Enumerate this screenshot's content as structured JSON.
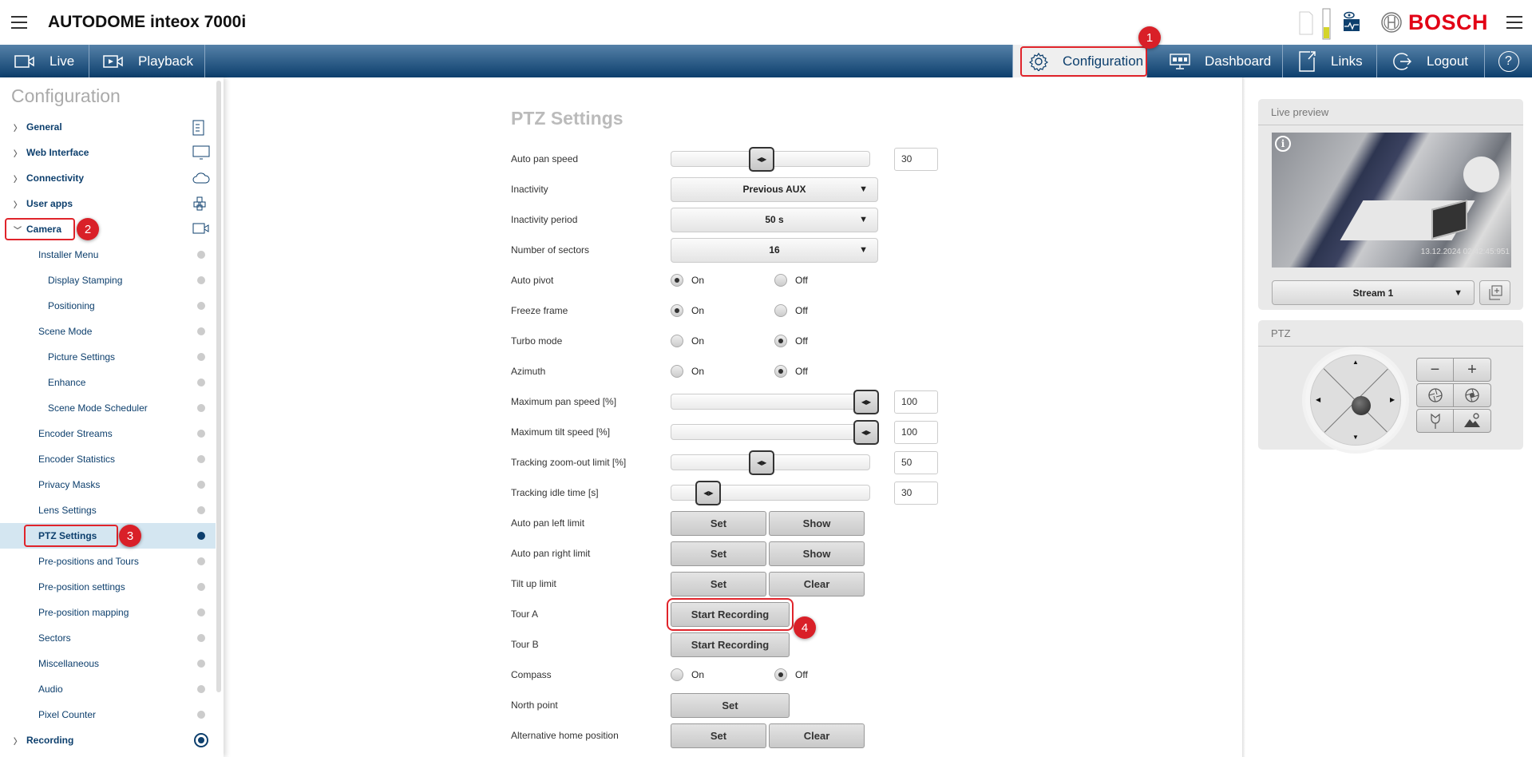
{
  "header": {
    "title": "AUTODOME inteox 7000i",
    "brand": "BOSCH"
  },
  "nav": {
    "live": "Live",
    "playback": "Playback",
    "configuration": "Configuration",
    "dashboard": "Dashboard",
    "links": "Links",
    "logout": "Logout",
    "help": "?"
  },
  "sidebar": {
    "title": "Configuration",
    "items": [
      {
        "label": "General",
        "level": 0,
        "icon": "checklist-icon"
      },
      {
        "label": "Web Interface",
        "level": 0,
        "icon": "monitor-icon"
      },
      {
        "label": "Connectivity",
        "level": 0,
        "icon": "cloud-icon"
      },
      {
        "label": "User apps",
        "level": 0,
        "icon": "apps-cubes-icon"
      },
      {
        "label": "Camera",
        "level": 0,
        "icon": "camera-icon",
        "expanded": true
      },
      {
        "label": "Installer Menu",
        "level": 1
      },
      {
        "label": "Display Stamping",
        "level": 2
      },
      {
        "label": "Positioning",
        "level": 2
      },
      {
        "label": "Scene Mode",
        "level": 1
      },
      {
        "label": "Picture Settings",
        "level": 2
      },
      {
        "label": "Enhance",
        "level": 2
      },
      {
        "label": "Scene Mode Scheduler",
        "level": 2
      },
      {
        "label": "Encoder Streams",
        "level": 1
      },
      {
        "label": "Encoder Statistics",
        "level": 1
      },
      {
        "label": "Privacy Masks",
        "level": 1
      },
      {
        "label": "Lens Settings",
        "level": 1
      },
      {
        "label": "PTZ Settings",
        "level": 1,
        "selected": true
      },
      {
        "label": "Pre-positions and Tours",
        "level": 1
      },
      {
        "label": "Pre-position settings",
        "level": 1
      },
      {
        "label": "Pre-position mapping",
        "level": 1
      },
      {
        "label": "Sectors",
        "level": 1
      },
      {
        "label": "Miscellaneous",
        "level": 1
      },
      {
        "label": "Audio",
        "level": 1
      },
      {
        "label": "Pixel Counter",
        "level": 1
      },
      {
        "label": "Recording",
        "level": 0,
        "icon": "recording-icon"
      }
    ]
  },
  "main": {
    "title": "PTZ Settings",
    "rows": [
      {
        "label": "Auto pan speed",
        "type": "slider",
        "value": "30",
        "fraction": 0.45
      },
      {
        "label": "Inactivity",
        "type": "select",
        "value": "Previous AUX"
      },
      {
        "label": "Inactivity period",
        "type": "select",
        "value": "50 s"
      },
      {
        "label": "Number of sectors",
        "type": "select",
        "value": "16"
      },
      {
        "label": "Auto pivot",
        "type": "radio",
        "on": "On",
        "off": "Off",
        "selected": "on"
      },
      {
        "label": "Freeze frame",
        "type": "radio",
        "on": "On",
        "off": "Off",
        "selected": "on"
      },
      {
        "label": "Turbo mode",
        "type": "radio",
        "on": "On",
        "off": "Off",
        "selected": "off"
      },
      {
        "label": "Azimuth",
        "type": "radio",
        "on": "On",
        "off": "Off",
        "selected": "off"
      },
      {
        "label": "Maximum pan speed [%]",
        "type": "slider",
        "value": "100",
        "fraction": 1.0
      },
      {
        "label": "Maximum tilt speed [%]",
        "type": "slider",
        "value": "100",
        "fraction": 1.0
      },
      {
        "label": "Tracking zoom-out limit [%]",
        "type": "slider",
        "value": "50",
        "fraction": 0.45
      },
      {
        "label": "Tracking idle time [s]",
        "type": "slider",
        "value": "30",
        "fraction": 0.17
      },
      {
        "label": "Auto pan left limit",
        "type": "buttons",
        "buttons": [
          "Set",
          "Show"
        ]
      },
      {
        "label": "Auto pan right limit",
        "type": "buttons",
        "buttons": [
          "Set",
          "Show"
        ]
      },
      {
        "label": "Tilt up limit",
        "type": "buttons",
        "buttons": [
          "Set",
          "Clear"
        ]
      },
      {
        "label": "Tour A",
        "type": "wide",
        "buttons": [
          "Start Recording"
        ],
        "highlight": true
      },
      {
        "label": "Tour B",
        "type": "wide",
        "buttons": [
          "Start Recording"
        ]
      },
      {
        "label": "Compass",
        "type": "radio",
        "on": "On",
        "off": "Off",
        "selected": "off"
      },
      {
        "label": "North point",
        "type": "wide",
        "buttons": [
          "Set"
        ]
      },
      {
        "label": "Alternative home position",
        "type": "buttons",
        "buttons": [
          "Set",
          "Clear"
        ]
      }
    ]
  },
  "live_preview": {
    "title": "Live preview",
    "timestamp": "13.12.2024 02:42:45:951",
    "stream": "Stream 1"
  },
  "ptz": {
    "title": "PTZ"
  },
  "annotations": [
    "1",
    "2",
    "3",
    "4"
  ],
  "colors": {
    "accent": "#0d3f6d",
    "highlight": "#e0242b",
    "brand": "#e20015",
    "selected_row": "#d4e6f1"
  }
}
